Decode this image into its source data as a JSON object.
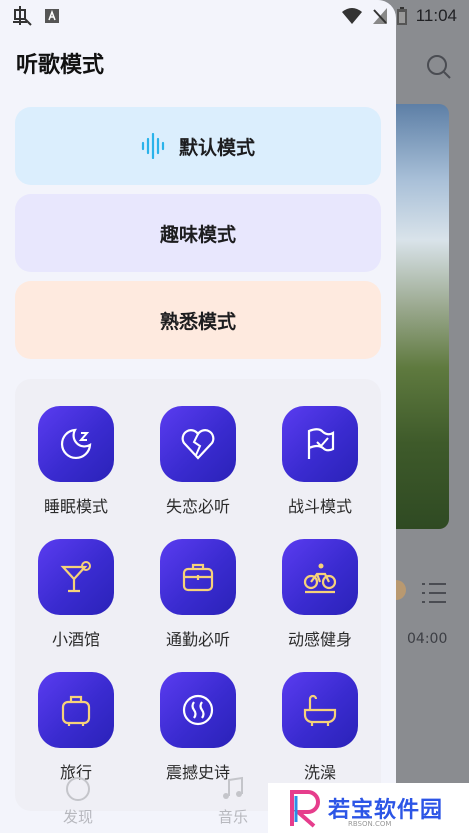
{
  "status_bar": {
    "time": "11:04"
  },
  "background": {
    "duration": "04:00"
  },
  "drawer": {
    "title": "听歌模式",
    "modes": [
      {
        "label": "默认模式",
        "color": "#dbeefd"
      },
      {
        "label": "趣味模式",
        "color": "#e8e7fd"
      },
      {
        "label": "熟悉模式",
        "color": "#feeadf"
      }
    ],
    "scenes": [
      {
        "label": "睡眠模式",
        "icon": "moon-icon"
      },
      {
        "label": "失恋必听",
        "icon": "broken-heart-icon"
      },
      {
        "label": "战斗模式",
        "icon": "flag-icon"
      },
      {
        "label": "小酒馆",
        "icon": "cocktail-icon"
      },
      {
        "label": "通勤必听",
        "icon": "briefcase-icon"
      },
      {
        "label": "动感健身",
        "icon": "bicycle-icon"
      },
      {
        "label": "旅行",
        "icon": "luggage-icon"
      },
      {
        "label": "震撼史诗",
        "icon": "vibration-icon"
      },
      {
        "label": "洗澡",
        "icon": "bathtub-icon"
      }
    ]
  },
  "bottom_nav": {
    "items": [
      "发现",
      "音乐"
    ]
  },
  "watermark": {
    "text": "若宝软件园",
    "sub": "RBSON.COM"
  },
  "colors": {
    "tile_gradient_start": "#5a3cf0",
    "tile_gradient_end": "#2a22b8"
  }
}
